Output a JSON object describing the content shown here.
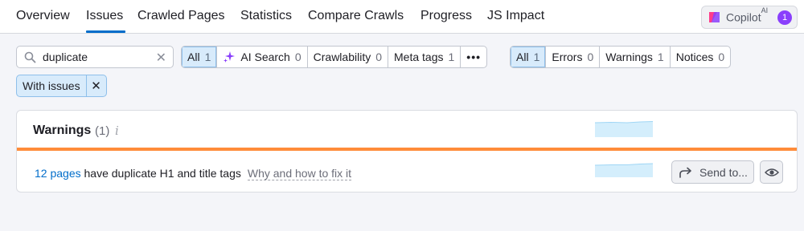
{
  "nav": {
    "tabs": [
      {
        "label": "Overview"
      },
      {
        "label": "Issues"
      },
      {
        "label": "Crawled Pages"
      },
      {
        "label": "Statistics"
      },
      {
        "label": "Compare Crawls"
      },
      {
        "label": "Progress"
      },
      {
        "label": "JS Impact"
      }
    ],
    "active_tab": "Issues",
    "copilot": {
      "label": "Copilot",
      "superscript": "AI",
      "badge": "1"
    }
  },
  "filters": {
    "search": {
      "value": "duplicate",
      "clear_icon": "close-icon"
    },
    "category": [
      {
        "label": "All",
        "count": "1",
        "active": true
      },
      {
        "label": "AI Search",
        "count": "0",
        "icon": "sparkle-icon"
      },
      {
        "label": "Crawlability",
        "count": "0"
      },
      {
        "label": "Meta tags",
        "count": "1"
      },
      {
        "label": "•••",
        "count": ""
      }
    ],
    "severity": [
      {
        "label": "All",
        "count": "1",
        "active": true
      },
      {
        "label": "Errors",
        "count": "0"
      },
      {
        "label": "Warnings",
        "count": "1"
      },
      {
        "label": "Notices",
        "count": "0"
      }
    ],
    "chip": {
      "label": "With issues"
    }
  },
  "card": {
    "title": "Warnings",
    "count": "(1)",
    "info": "i",
    "row": {
      "link": "12 pages",
      "text": " have duplicate H1 and title tags",
      "why": "Why and how to fix it",
      "send_label": "Send to..."
    }
  },
  "colors": {
    "accent": "#006dca",
    "warning": "#ff8c3a",
    "copilot": "#8a3ffc",
    "spark": "#d4eefc"
  }
}
